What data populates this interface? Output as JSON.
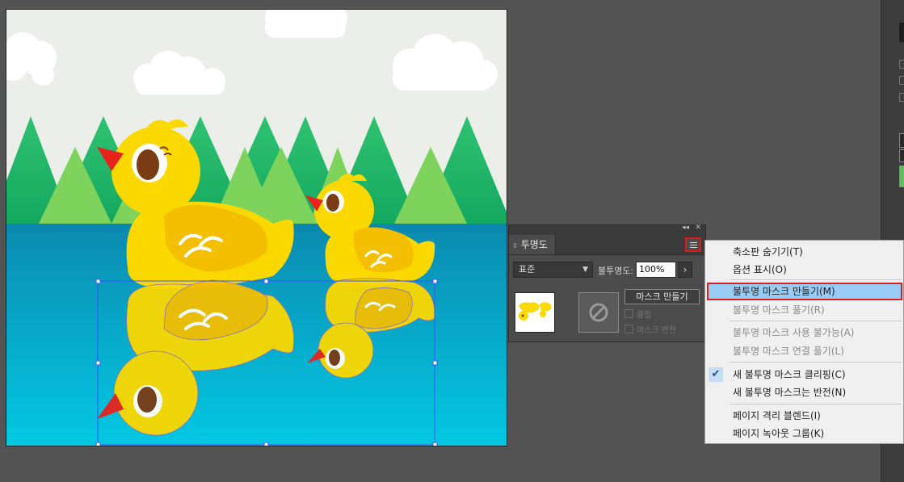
{
  "document": {
    "sky_color": "#eceee9",
    "water_color_top": "#0c8ab0",
    "water_color_bottom": "#03c8e2",
    "duck_color": "#fbd800",
    "wing_color": "#f4bf00",
    "beak_color": "#e8231d",
    "tree_dark": "#23b46a",
    "tree_light": "#7ed35c",
    "selection_color": "#3355ff"
  },
  "transparency_panel": {
    "tab_label": "투명도",
    "tab_arrows_icon": "double-arrow-icon",
    "collapse_icon": "double-chevron-left-icon",
    "close_icon": "close-icon",
    "blend_mode": "표준",
    "opacity_label": "불투명도:",
    "opacity_value": "100%",
    "make_mask_button": "마스크 만들기",
    "clip_label": "클립",
    "invert_mask_label": "마스크 반전"
  },
  "flyout_menu": {
    "items": [
      {
        "label": "축소판 숨기기(T)",
        "enabled": true
      },
      {
        "label": "옵션 표시(O)",
        "enabled": true
      },
      {
        "label": "불투명 마스크 만들기(M)",
        "enabled": true,
        "highlighted": true
      },
      {
        "label": "불투명 마스크 풀기(R)",
        "enabled": false
      },
      {
        "label": "불투명 마스크 사용 불가능(A)",
        "enabled": false
      },
      {
        "label": "불투명 마스크 연결 풀기(L)",
        "enabled": false
      },
      {
        "label": "새 불투명 마스크 클리핑(C)",
        "enabled": true,
        "checked": true
      },
      {
        "label": "새 불투명 마스크는 반전(N)",
        "enabled": true
      },
      {
        "label": "페이지 격리 블렌드(I)",
        "enabled": true
      },
      {
        "label": "페이지 녹아웃 그룹(K)",
        "enabled": true
      }
    ]
  }
}
